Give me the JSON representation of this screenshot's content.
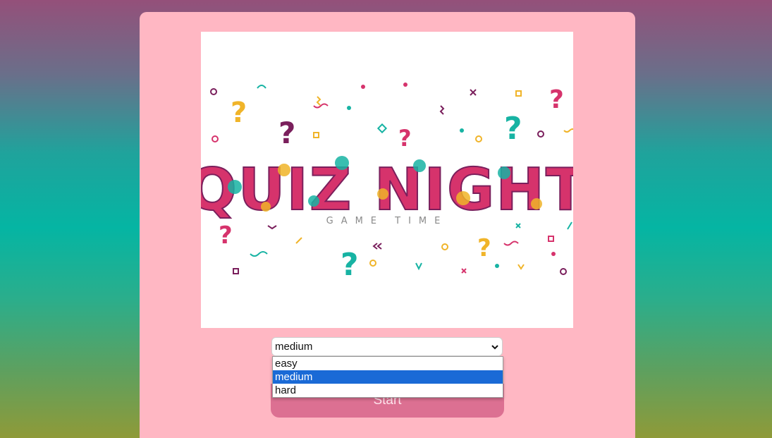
{
  "hero": {
    "title": "QUIZ NIGHT",
    "subtitle": "GAME TIME"
  },
  "difficulty": {
    "selected": "medium",
    "options": [
      "easy",
      "medium",
      "hard"
    ],
    "selected_index": 1
  },
  "start_label": "Start",
  "colors": {
    "card_bg": "#ffb7c3",
    "button_bg": "#dc7092",
    "highlight": "#1a6ad6",
    "teal": "#17b3a3",
    "magenta": "#d6336c",
    "purple": "#7a1f5c",
    "yellow": "#f0b429"
  }
}
